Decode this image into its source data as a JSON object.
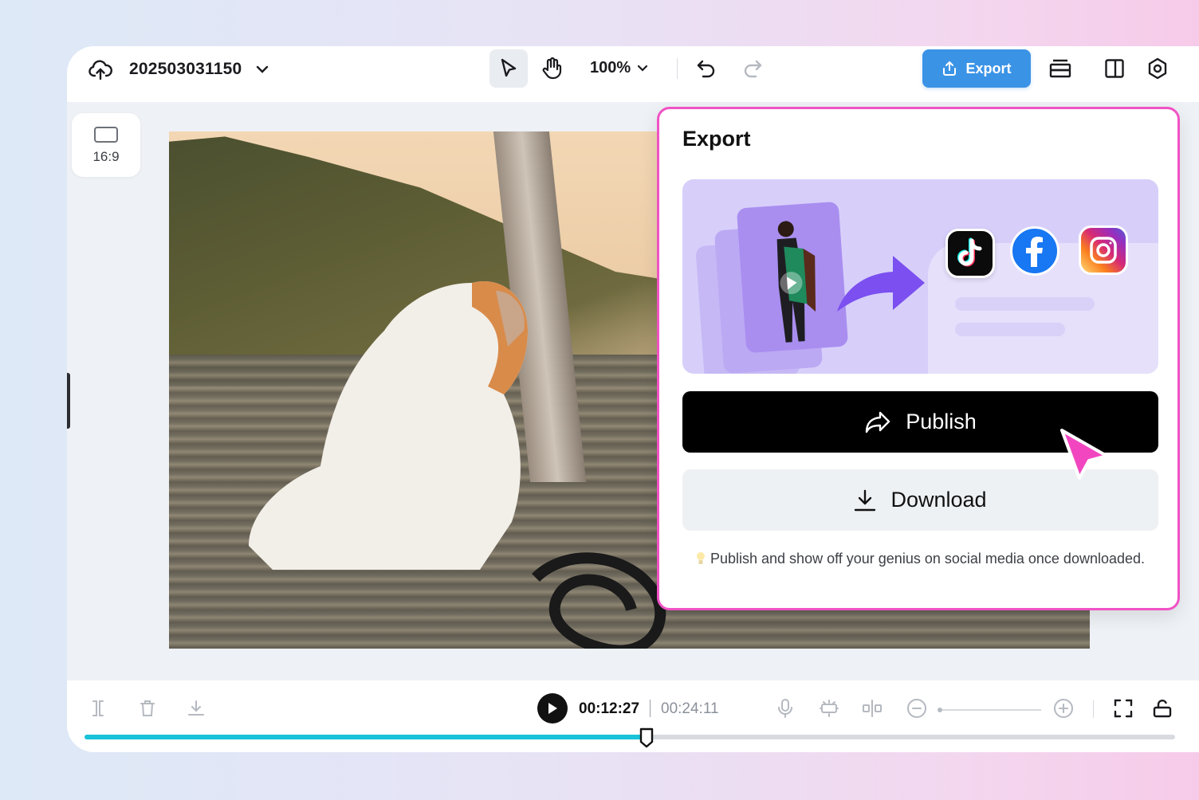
{
  "header": {
    "project_name": "202503031150",
    "zoom_label": "100%",
    "export_label": "Export"
  },
  "canvas": {
    "aspect_ratio_label": "16:9"
  },
  "export_panel": {
    "title": "Export",
    "publish_label": "Publish",
    "download_label": "Download",
    "hint": "Publish and show off your genius on social media once downloaded.",
    "platforms": [
      "tiktok-icon",
      "facebook-icon",
      "instagram-icon"
    ]
  },
  "playback": {
    "current_time": "00:12:27",
    "total_time": "00:24:11",
    "progress": 0.515
  },
  "colors": {
    "accent": "#3b93e6",
    "panel_border": "#f052c5",
    "progress": "#19c3d8"
  }
}
